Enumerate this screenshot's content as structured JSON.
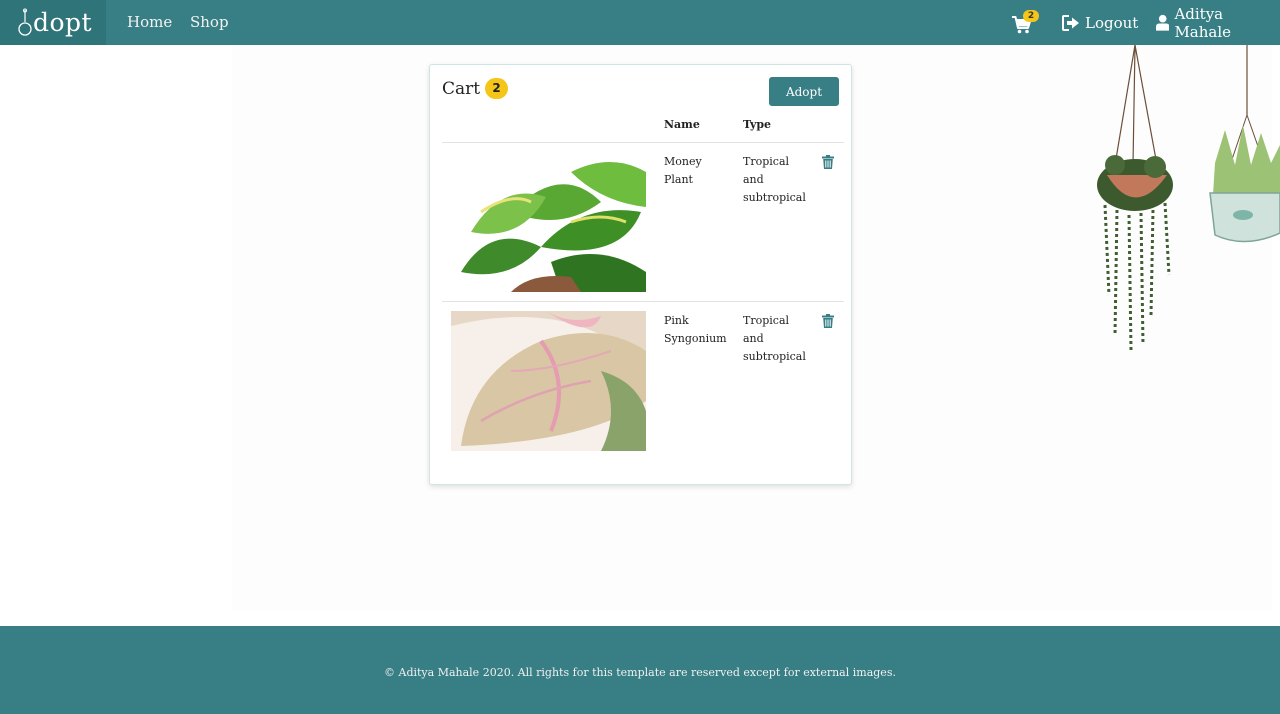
{
  "navbar": {
    "brand": "dopt",
    "brand_icon": "bulb-icon",
    "links": [
      "Home",
      "Shop"
    ],
    "cart_count": "2",
    "logout_label": "Logout",
    "user_name": "Aditya Mahale",
    "bg_color": "#377f85"
  },
  "cart": {
    "title": "Cart",
    "count": "2",
    "adopt_label": "Adopt",
    "headers": {
      "name": "Name",
      "type": "Type"
    },
    "items": [
      {
        "name_line1": "Money",
        "name_line2": "Plant",
        "type_line1": "Tropical",
        "type_line2": "and",
        "type_line3": "subtropical",
        "image": "money-plant-image"
      },
      {
        "name_line1": "Pink",
        "name_line2": "Syngonium",
        "type_line1": "Tropical",
        "type_line2": "and",
        "type_line3": "subtropical",
        "image": "pink-syngonium-image"
      }
    ]
  },
  "colors": {
    "accent": "#377f85",
    "badge": "#f5c518"
  },
  "footer": {
    "text": "© Aditya Mahale 2020. All rights for this template are reserved except for external images."
  }
}
